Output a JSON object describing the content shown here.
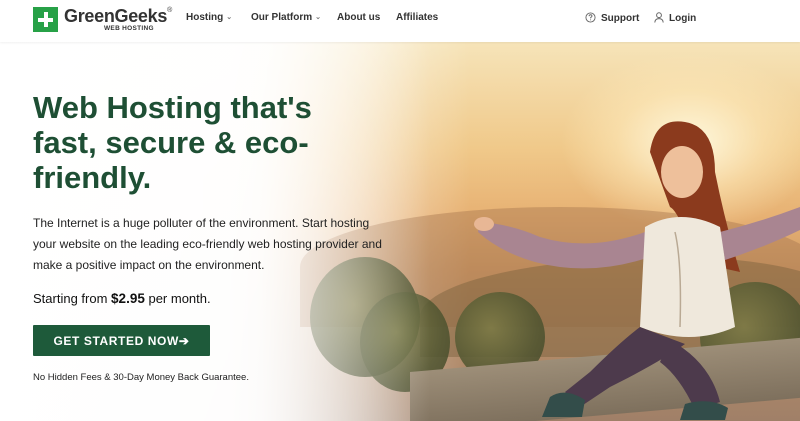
{
  "header": {
    "logo": {
      "name": "GreenGeeks",
      "trademark": "®",
      "subtitle": "WEB HOSTING"
    },
    "nav": [
      {
        "label": "Hosting",
        "has_dropdown": true
      },
      {
        "label": "Our Platform",
        "has_dropdown": true
      },
      {
        "label": "About us",
        "has_dropdown": false
      },
      {
        "label": "Affiliates",
        "has_dropdown": false
      }
    ],
    "support_label": "Support",
    "login_label": "Login"
  },
  "hero": {
    "headline": "Web Hosting that's fast, secure & eco-friendly.",
    "intro": "The Internet is a huge polluter of the environment. Start hosting your website on the leading eco-friendly web hosting provider and make a positive impact on the environment.",
    "price_prefix": "Starting from",
    "price": "$2.95",
    "price_suffix": "per month.",
    "cta_label": "GET STARTED NOW➔",
    "guarantee": "No Hidden Fees & 30-Day Money Back Guarantee."
  },
  "colors": {
    "brand_green": "#27a147",
    "headline_green": "#1e4f34",
    "cta_green": "#1e5a3a"
  },
  "icons": {
    "support": "question-circle-icon",
    "login": "user-icon",
    "dropdown": "chevron-down-icon"
  }
}
